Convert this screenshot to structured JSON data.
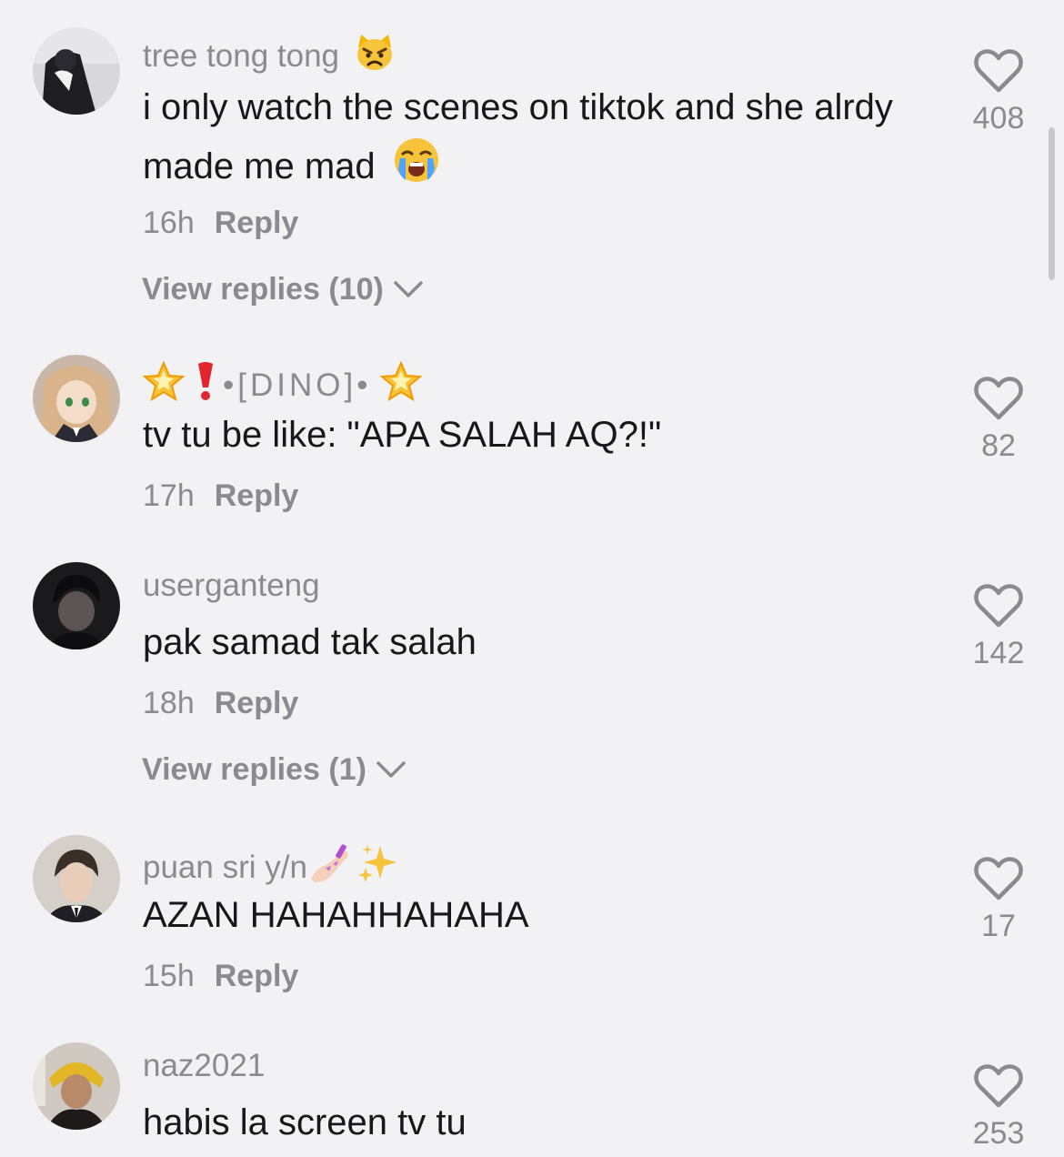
{
  "comments": [
    {
      "username": "tree tong tong",
      "username_emoji": "pouting-cat-emoji",
      "text": "i only watch the scenes on tiktok and she alrdy made me mad",
      "text_emoji": "loudly-crying-face-emoji",
      "time": "16h",
      "reply_label": "Reply",
      "view_replies": "View replies (10)",
      "likes": "408"
    },
    {
      "username": "•[DINO]•",
      "username_emoji": "glowing-star-emoji, red-exclamation-emoji, glowing-star-emoji",
      "text": "tv tu be like: \"APA SALAH AQ?!\"",
      "time": "17h",
      "reply_label": "Reply",
      "likes": "82"
    },
    {
      "username": "userganteng",
      "text": "pak samad tak salah",
      "time": "18h",
      "reply_label": "Reply",
      "view_replies": "View replies (1)",
      "likes": "142"
    },
    {
      "username": "puan sri y/n",
      "username_emoji": "nail-polish-emoji, sparkles-emoji",
      "text": "AZAN HAHAHHAHAHA",
      "time": "15h",
      "reply_label": "Reply",
      "likes": "17"
    },
    {
      "username": "naz2021",
      "text": "habis la screen tv tu",
      "likes": "253"
    }
  ],
  "colors": {
    "background": "#f2f2f4",
    "primary_text": "#17171c",
    "secondary_text": "#8a8a90"
  },
  "icons": [
    "heart-outline-icon",
    "chevron-down-icon",
    "scrollbar"
  ]
}
